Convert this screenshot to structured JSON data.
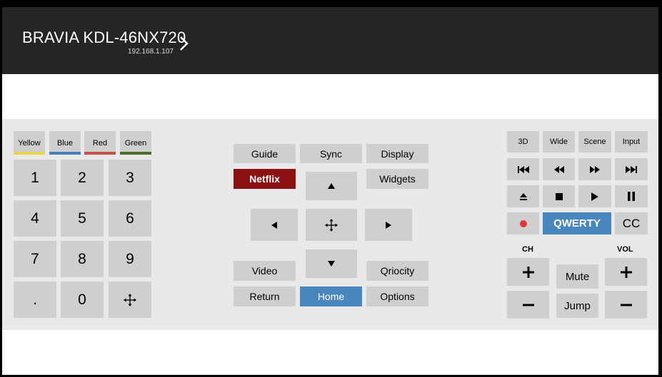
{
  "header": {
    "device_name": "BRAVIA KDL-46NX720",
    "ip_address": "192.168.1.107"
  },
  "color_buttons": [
    {
      "label": "Yellow",
      "color": "#e6d44a"
    },
    {
      "label": "Blue",
      "color": "#4a7ec2"
    },
    {
      "label": "Red",
      "color": "#c94c4c"
    },
    {
      "label": "Green",
      "color": "#4d6b2a"
    }
  ],
  "keypad": [
    "1",
    "2",
    "3",
    "4",
    "5",
    "6",
    "7",
    "8",
    "9",
    ".",
    "0"
  ],
  "nav": {
    "guide": "Guide",
    "sync": "Sync",
    "display": "Display",
    "netflix": "Netflix",
    "widgets": "Widgets",
    "video": "Video",
    "qriocity": "Qriocity",
    "return": "Return",
    "home": "Home",
    "options": "Options"
  },
  "right": {
    "threed": "3D",
    "wide": "Wide",
    "scene": "Scene",
    "input": "Input",
    "qwerty": "QWERTY",
    "cc": "CC",
    "ch_label": "CH",
    "vol_label": "VOL",
    "mute": "Mute",
    "jump": "Jump"
  },
  "colors": {
    "netflix": "#8b1212",
    "accent_blue": "#4a86be",
    "record": "#e03838",
    "header_bg": "#252525",
    "button_bg": "#cfcfcf"
  },
  "icons": {
    "prev_track": "skip-back-icon",
    "rewind": "rewind-icon",
    "fast_forward": "fast-forward-icon",
    "next_track": "skip-forward-icon",
    "eject": "eject-icon",
    "stop": "stop-icon",
    "play": "play-icon",
    "pause": "pause-icon",
    "record": "record-icon"
  }
}
